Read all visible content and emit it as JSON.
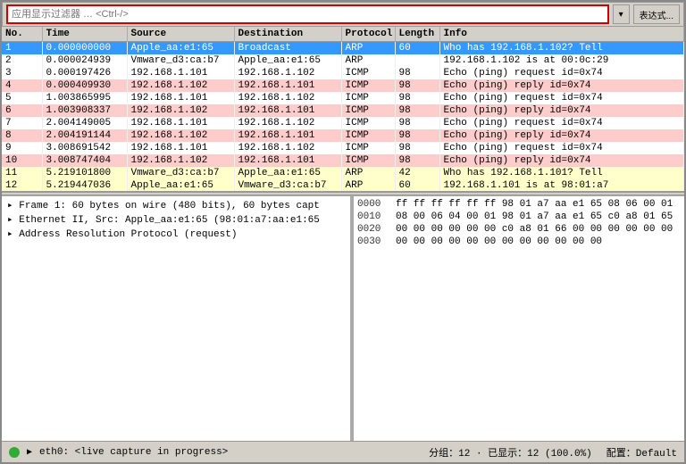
{
  "filter_bar": {
    "placeholder": "应用显示过滤器 … <Ctrl-/>",
    "dropdown_btn": "▾",
    "expr_btn": "表达式..."
  },
  "columns": {
    "no": "No.",
    "time": "Time",
    "source": "Source",
    "destination": "Destination",
    "protocol": "Protocol",
    "length": "Length",
    "info": "Info"
  },
  "packets": [
    {
      "no": "1",
      "time": "0.000000000",
      "source": "Apple_aa:e1:65",
      "destination": "Broadcast",
      "protocol": "ARP",
      "length": "60",
      "info": "Who has 192.168.1.102? Tell",
      "row_class": "row-arp-selected"
    },
    {
      "no": "2",
      "time": "0.000024939",
      "source": "Vmware_d3:ca:b7",
      "destination": "Apple_aa:e1:65",
      "protocol": "ARP",
      "length": "",
      "info": "192.168.1.102 is at 00:0c:29",
      "row_class": "row-white"
    },
    {
      "no": "3",
      "time": "0.000197426",
      "source": "192.168.1.101",
      "destination": "192.168.1.102",
      "protocol": "ICMP",
      "length": "98",
      "info": "Echo (ping) request  id=0x74",
      "row_class": "row-white"
    },
    {
      "no": "4",
      "time": "0.000409930",
      "source": "192.168.1.102",
      "destination": "192.168.1.101",
      "protocol": "ICMP",
      "length": "98",
      "info": "Echo (ping) reply    id=0x74",
      "row_class": "row-pink"
    },
    {
      "no": "5",
      "time": "1.003865995",
      "source": "192.168.1.101",
      "destination": "192.168.1.102",
      "protocol": "ICMP",
      "length": "98",
      "info": "Echo (ping) request  id=0x74",
      "row_class": "row-white"
    },
    {
      "no": "6",
      "time": "1.003908337",
      "source": "192.168.1.102",
      "destination": "192.168.1.101",
      "protocol": "ICMP",
      "length": "98",
      "info": "Echo (ping) reply    id=0x74",
      "row_class": "row-pink"
    },
    {
      "no": "7",
      "time": "2.004149005",
      "source": "192.168.1.101",
      "destination": "192.168.1.102",
      "protocol": "ICMP",
      "length": "98",
      "info": "Echo (ping) request  id=0x74",
      "row_class": "row-white"
    },
    {
      "no": "8",
      "time": "2.004191144",
      "source": "192.168.1.102",
      "destination": "192.168.1.101",
      "protocol": "ICMP",
      "length": "98",
      "info": "Echo (ping) reply    id=0x74",
      "row_class": "row-pink"
    },
    {
      "no": "9",
      "time": "3.008691542",
      "source": "192.168.1.101",
      "destination": "192.168.1.102",
      "protocol": "ICMP",
      "length": "98",
      "info": "Echo (ping) request  id=0x74",
      "row_class": "row-white"
    },
    {
      "no": "10",
      "time": "3.008747404",
      "source": "192.168.1.102",
      "destination": "192.168.1.101",
      "protocol": "ICMP",
      "length": "98",
      "info": "Echo (ping) reply    id=0x74",
      "row_class": "row-pink"
    },
    {
      "no": "11",
      "time": "5.219101800",
      "source": "Vmware_d3:ca:b7",
      "destination": "Apple_aa:e1:65",
      "protocol": "ARP",
      "length": "42",
      "info": "Who has 192.168.1.101? Tell",
      "row_class": "row-yellow"
    },
    {
      "no": "12",
      "time": "5.219447036",
      "source": "Apple_aa:e1:65",
      "destination": "Vmware_d3:ca:b7",
      "protocol": "ARP",
      "length": "60",
      "info": "192.168.1.101 is at 98:01:a7",
      "row_class": "row-yellow"
    }
  ],
  "detail_rows": [
    {
      "text": "▸ Frame 1: 60 bytes on wire (480 bits), 60 bytes capt"
    },
    {
      "text": "▸ Ethernet II, Src: Apple_aa:e1:65 (98:01:a7:aa:e1:65"
    },
    {
      "text": "▸ Address Resolution Protocol (request)"
    }
  ],
  "hex_rows": [
    {
      "offset": "0000",
      "bytes": "ff ff ff ff ff ff 98 01  a7 aa e1 65 08 06 00 01",
      "ascii": ""
    },
    {
      "offset": "0010",
      "bytes": "08 00 06 04 00 01 98 01  a7 aa e1 65 c0 a8 01 65",
      "ascii": ""
    },
    {
      "offset": "0020",
      "bytes": "00 00 00 00 00 00 c0 a8  01 66 00 00 00 00 00 00",
      "ascii": ""
    },
    {
      "offset": "0030",
      "bytes": "00 00 00 00 00 00 00 00  00 00 00 00",
      "ascii": ""
    }
  ],
  "status": {
    "interface": "eth0",
    "capture_status": "<live capture in progress>",
    "stats": "分组：12 · 已显示：12 (100.0%)",
    "profile": "配置：Default"
  }
}
